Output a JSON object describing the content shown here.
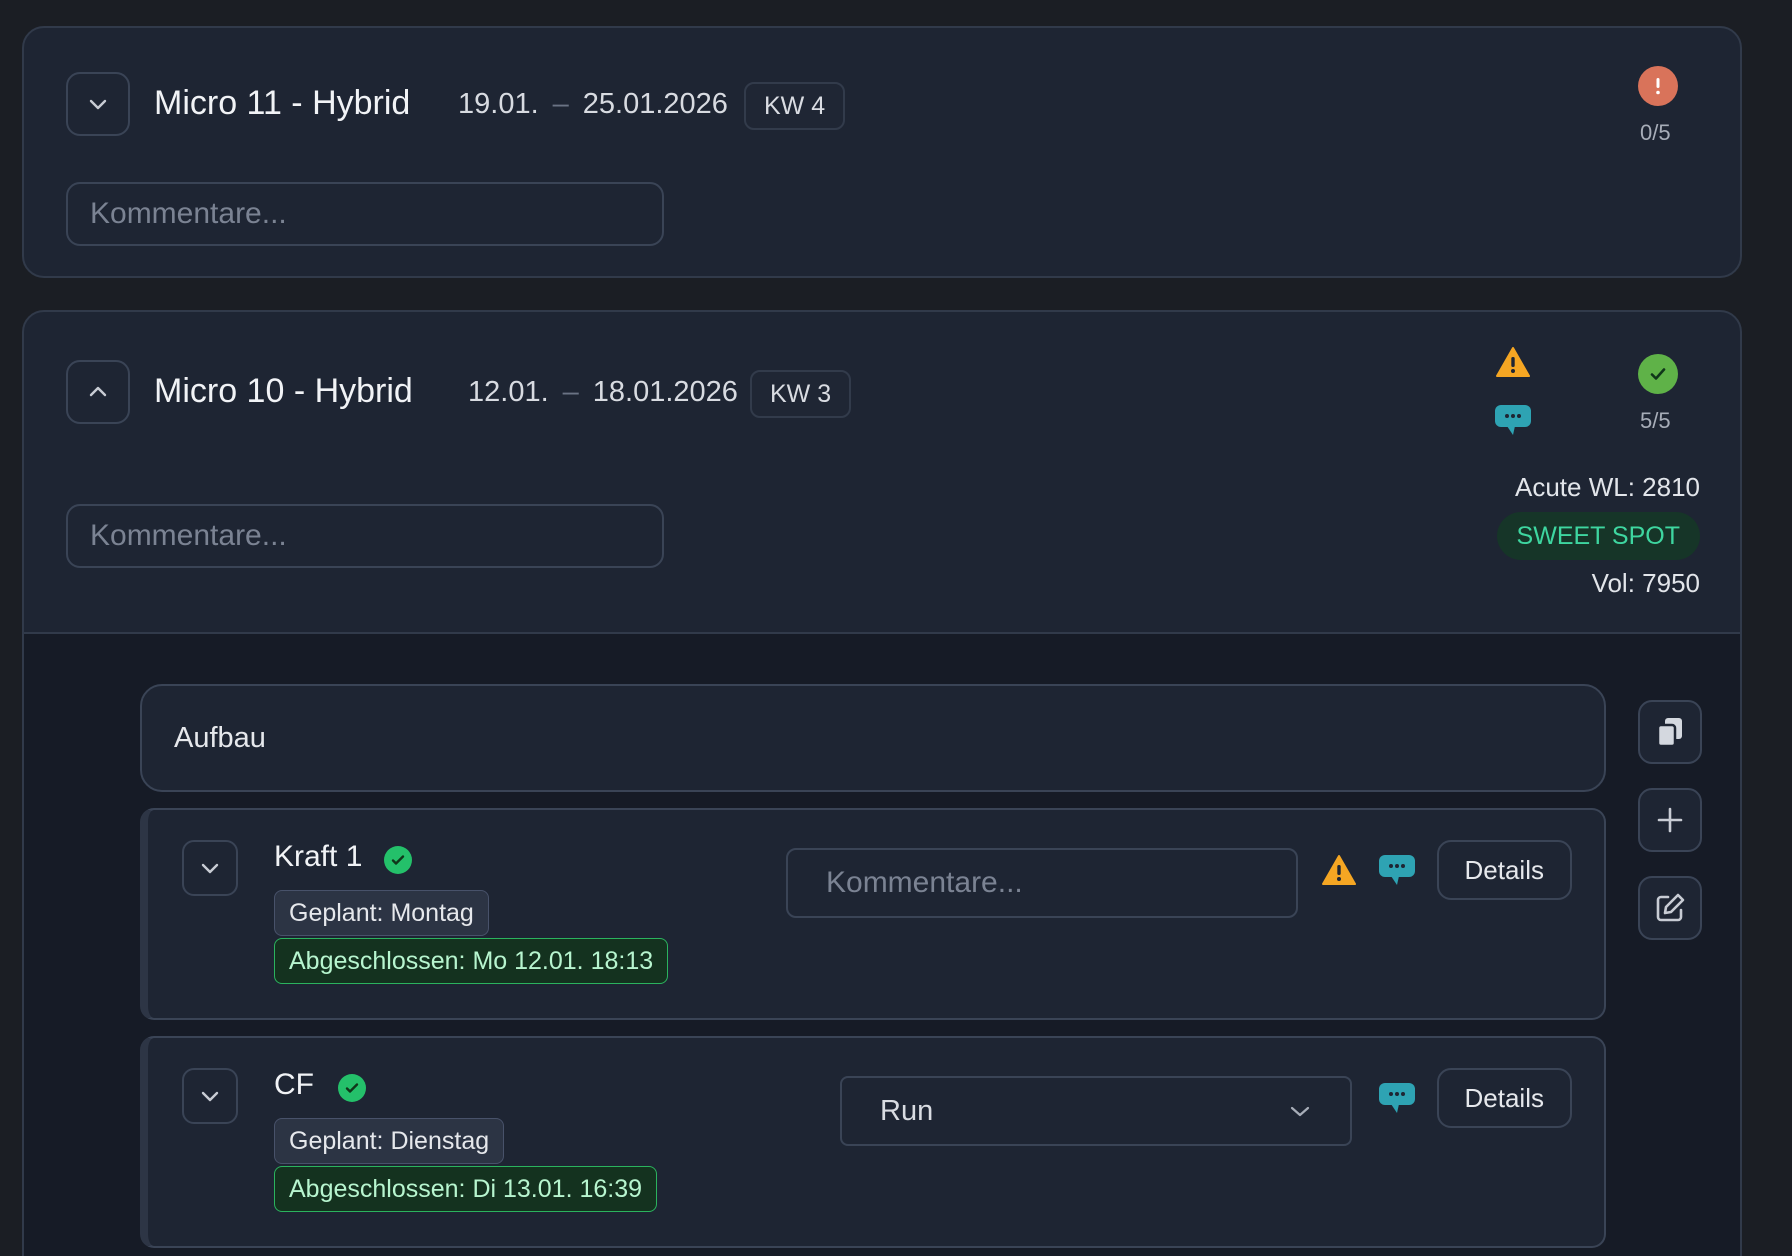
{
  "micro11": {
    "title": "Micro 11 - Hybrid",
    "date_start": "19.01.",
    "date_end": "25.01.2026",
    "kw": "KW 4",
    "comment_placeholder": "Kommentare...",
    "count": "0/5",
    "status_icon": "alert-icon",
    "status_color": "#d9735a"
  },
  "micro10": {
    "title": "Micro 10 - Hybrid",
    "date_start": "12.01.",
    "date_end": "18.01.2026",
    "kw": "KW 3",
    "comment_placeholder": "Kommentare...",
    "count": "5/5",
    "acute_wl": "Acute WL: 2810",
    "zone": "SWEET SPOT",
    "vol": "Vol: 7950",
    "warning_color": "#f5a623",
    "chat_color": "#2ea3b3",
    "ok_color": "#5fb248",
    "section": {
      "label": "Aufbau"
    },
    "workouts": [
      {
        "name": "Kraft 1",
        "planned": "Geplant: Montag",
        "completed": "Abgeschlossen: Mo 12.01. 18:13",
        "comment_placeholder": "Kommentare...",
        "details_label": "Details"
      },
      {
        "name": "CF",
        "planned": "Geplant: Dienstag",
        "completed": "Abgeschlossen: Di 13.01. 16:39",
        "select_value": "Run",
        "details_label": "Details"
      }
    ]
  }
}
